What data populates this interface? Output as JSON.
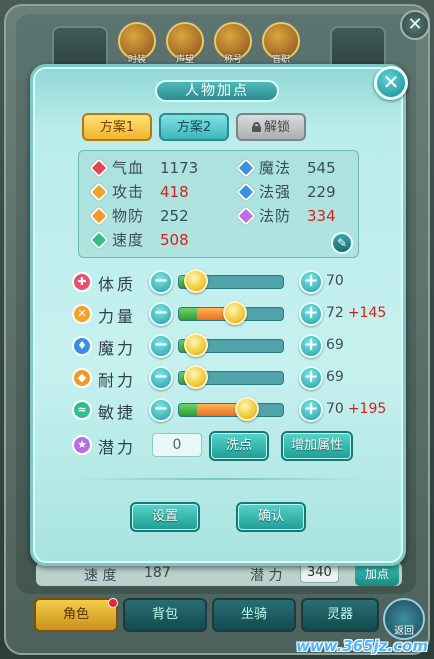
{
  "background": {
    "medals": [
      "时装",
      "声望",
      "称号",
      "官职"
    ],
    "bottom_stats": [
      {
        "label": "速 度",
        "value": "187"
      },
      {
        "label": "潜 力",
        "value": "340"
      }
    ],
    "add_button": "加点",
    "tabs": [
      "角色",
      "背包",
      "坐骑",
      "灵器"
    ],
    "back_label": "返回",
    "watermark": "www.365jz.com"
  },
  "dialog": {
    "title": "人物加点",
    "close_glyph": "✕",
    "plans": {
      "plan1": "方案1",
      "plan2": "方案2",
      "unlock": "解锁"
    },
    "stats": [
      {
        "label": "气血",
        "value": "1173",
        "highlight": false,
        "color": "#e0455a"
      },
      {
        "label": "魔法",
        "value": "545",
        "highlight": false,
        "color": "#3a8fe0"
      },
      {
        "label": "攻击",
        "value": "418",
        "highlight": true,
        "color": "#f0a52a"
      },
      {
        "label": "法强",
        "value": "229",
        "highlight": false,
        "color": "#3a8fe0"
      },
      {
        "label": "物防",
        "value": "252",
        "highlight": false,
        "color": "#f09a2a"
      },
      {
        "label": "法防",
        "value": "334",
        "highlight": true,
        "color": "#c06fe0"
      },
      {
        "label": "速度",
        "value": "508",
        "highlight": true,
        "color": "#2fc08a"
      }
    ],
    "attributes": [
      {
        "label": "体质",
        "value": "70",
        "bonus": "",
        "icon_color": "#e9506a",
        "glyph": "✚",
        "level": 0.17,
        "bonus_level": 0
      },
      {
        "label": "力量",
        "value": "72",
        "bonus": "+145",
        "icon_color": "#f1a22a",
        "glyph": "✕",
        "level": 0.17,
        "bonus_level": 0.37
      },
      {
        "label": "魔力",
        "value": "69",
        "bonus": "",
        "icon_color": "#3a8fe0",
        "glyph": "♦",
        "level": 0.17,
        "bonus_level": 0
      },
      {
        "label": "耐力",
        "value": "69",
        "bonus": "",
        "icon_color": "#f09a2a",
        "glyph": "◆",
        "level": 0.17,
        "bonus_level": 0
      },
      {
        "label": "敏捷",
        "value": "70",
        "bonus": "+195",
        "icon_color": "#2fc08a",
        "glyph": "≈",
        "level": 0.17,
        "bonus_level": 0.48
      }
    ],
    "potential": {
      "label": "潜力",
      "value": "0",
      "icon_color": "#b66fe0"
    },
    "wash_button": "洗点",
    "boost_button": "增加属性",
    "settings_button": "设置",
    "confirm_button": "确认"
  }
}
